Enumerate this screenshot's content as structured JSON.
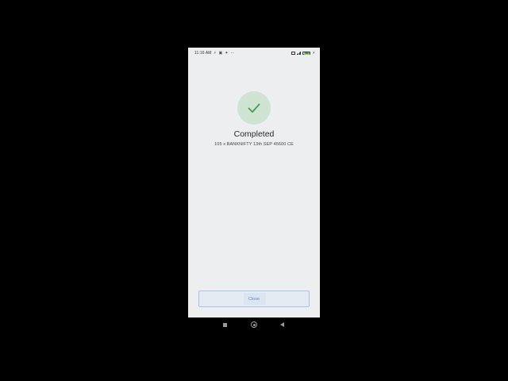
{
  "status_bar": {
    "time": "11:16 AM",
    "left_icons": [
      "charging-bolt-icon",
      "photo-icon",
      "vpn-key-icon",
      "more-dots-icon"
    ],
    "battery_level": "86",
    "right_icons": [
      "sim-icon",
      "signal-icon",
      "battery-icon",
      "charging-icon"
    ]
  },
  "result": {
    "icon": "check-icon",
    "title": "Completed",
    "description": "105 x BANKNIFTY 13th SEP 45600 CE"
  },
  "actions": {
    "close_label": "Close"
  },
  "nav_bar": {
    "buttons": [
      "recents-icon",
      "home-icon",
      "back-icon"
    ]
  },
  "colors": {
    "background": "#000000",
    "screen": "#eceeef",
    "success_circle": "#cfe3d2",
    "check": "#3ea055",
    "button_border": "#a9c3e0",
    "button_text": "#5a86c2"
  }
}
